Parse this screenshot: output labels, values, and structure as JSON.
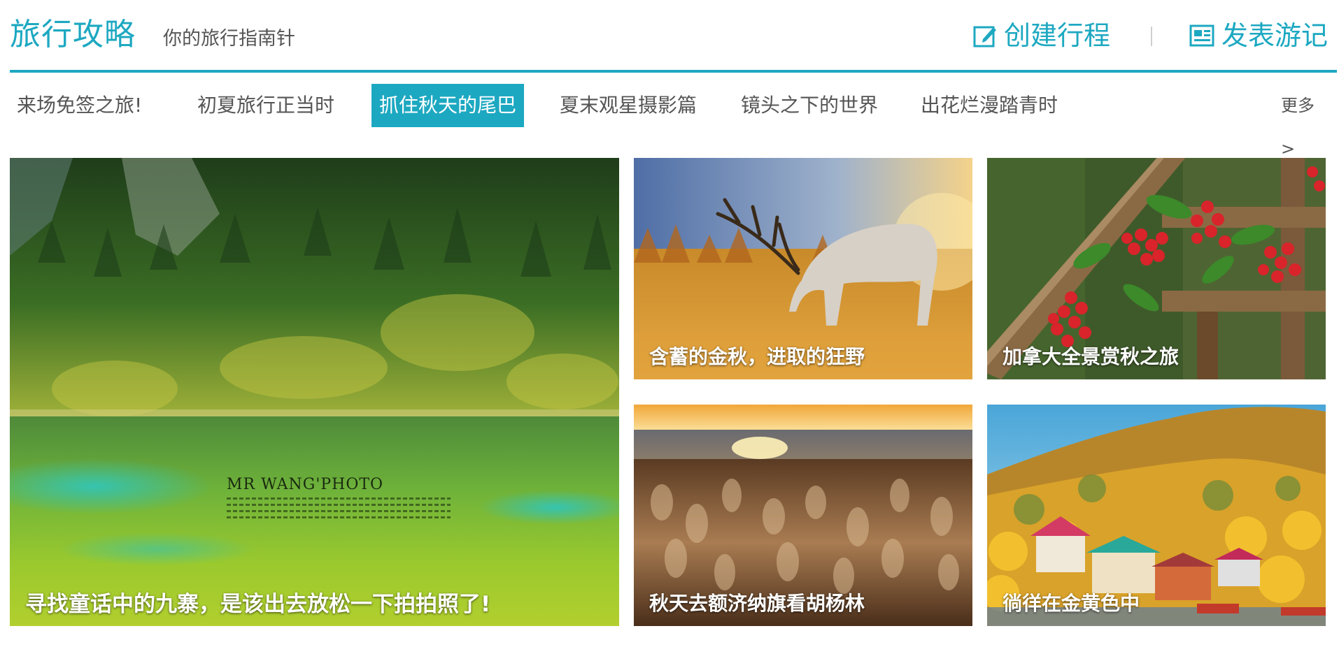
{
  "header": {
    "brand": "旅行攻略",
    "tagline": "你的旅行指南针",
    "create_label": "创建行程",
    "publish_label": "发表游记"
  },
  "tabs": [
    {
      "label": "来场免签之旅!",
      "active": false
    },
    {
      "label": "初夏旅行正当时",
      "active": false
    },
    {
      "label": "抓住秋天的尾巴",
      "active": true
    },
    {
      "label": "夏末观星摄影篇",
      "active": false
    },
    {
      "label": "镜头之下的世界",
      "active": false
    },
    {
      "label": "出花烂漫踏青时",
      "active": false
    }
  ],
  "more_label": "更多>",
  "cards": [
    {
      "caption": "寻找童话中的九寨，是该出去放松一下拍拍照了!",
      "watermark": "MR WANG'PHOTO"
    },
    {
      "caption": "含蓄的金秋，进取的狂野"
    },
    {
      "caption": "加拿大全景赏秋之旅"
    },
    {
      "caption": "秋天去额济纳旗看胡杨林"
    },
    {
      "caption": "徜徉在金黄色中"
    }
  ],
  "colors": {
    "accent": "#1da8c1",
    "text": "#555555",
    "divider": "#cfcfcf"
  },
  "icons": {
    "create": "edit-icon",
    "publish": "newspaper-icon"
  }
}
